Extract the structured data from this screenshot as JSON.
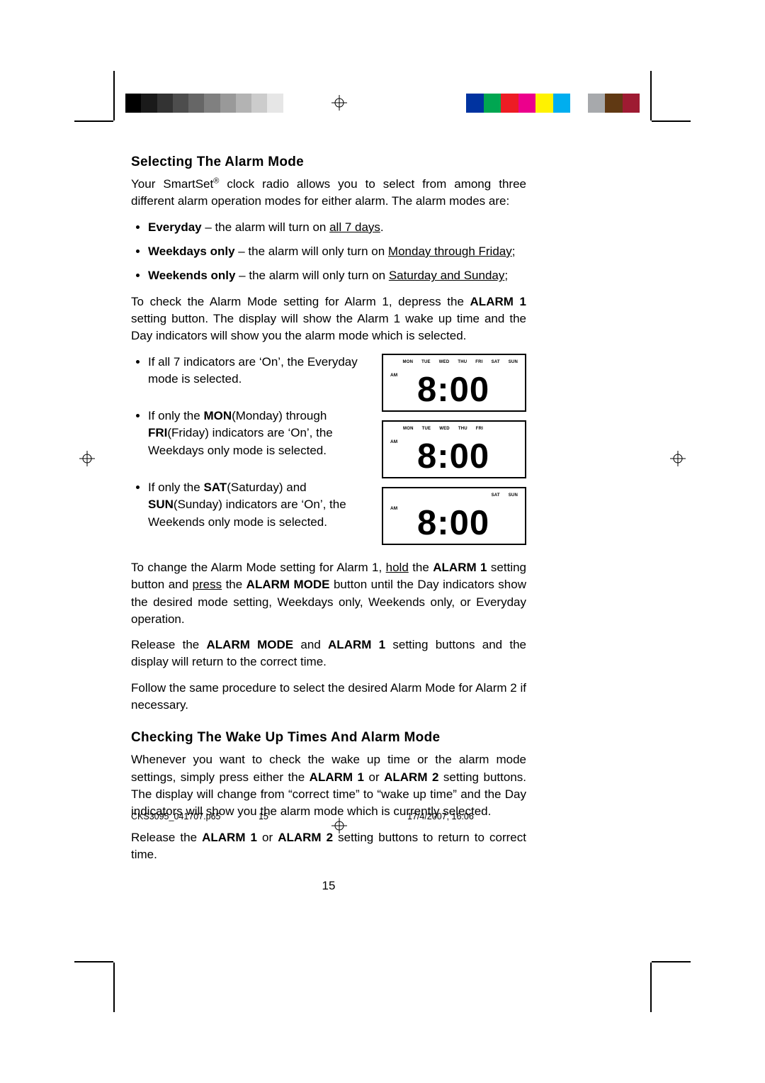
{
  "headings": {
    "h1": "Selecting The Alarm Mode",
    "h2": "Checking The Wake Up Times And Alarm Mode"
  },
  "intro": {
    "prefix": "Your SmartSet",
    "reg": "®",
    "rest": " clock radio allows you to select from among three different alarm operation modes for either alarm. The alarm modes are:"
  },
  "modes": {
    "everyday_b": "Everyday",
    "everyday_mid": " – the alarm will turn on ",
    "everyday_u": "all 7 days",
    "everyday_end": ".",
    "weekdays_b": "Weekdays only",
    "weekdays_mid": " – the alarm will only turn on ",
    "weekdays_u": "Monday through Friday",
    "weekdays_end": ";",
    "weekends_b": "Weekends only",
    "weekends_mid": " – the alarm will only turn on ",
    "weekends_u": "Saturday and Sunday",
    "weekends_end": ";"
  },
  "check": {
    "p1a": "To check the Alarm Mode setting for Alarm 1, depress the ",
    "p1b": "ALARM 1",
    "p1c": " setting button. The display will show the Alarm 1 wake up time and the Day indicators will show you the alarm mode which is selected."
  },
  "indicators": {
    "li1": "If all 7 indicators are ‘On’, the Everyday mode is selected.",
    "li2a": "If only the ",
    "li2b": "MON",
    "li2c": "(Monday) through ",
    "li2d": "FRI",
    "li2e": "(Friday) indicators are ‘On’, the Weekdays only mode is selected.",
    "li3a": "If only the ",
    "li3b": "SAT",
    "li3c": "(Saturday) and ",
    "li3d": "SUN",
    "li3e": "(Sunday) indicators are ‘On’, the Weekends only mode is selected."
  },
  "change": {
    "a": "To change the Alarm Mode setting for Alarm 1, ",
    "hold": "hold",
    "b": " the ",
    "alarm1": "ALARM 1",
    "c": " setting button and ",
    "press": "press",
    "d": " the ",
    "alarmmode": "ALARM MODE",
    "e": " button until the Day indicators show the desired mode setting, Weekdays only, Weekends only, or Everyday operation."
  },
  "release1": {
    "a": "Release the ",
    "b": "ALARM MODE",
    "c": " and ",
    "d": "ALARM 1",
    "e": " setting buttons and the display will return to the correct time."
  },
  "follow": "Follow the same procedure to select the desired Alarm Mode for Alarm 2 if necessary.",
  "checking": {
    "a": "Whenever you want to check the wake up time or the alarm mode settings, simply press either the ",
    "b": "ALARM 1",
    "c": " or ",
    "d": "ALARM 2",
    "e": " setting buttons. The display will change from “correct time” to “wake up time” and the Day indicators will show you the alarm mode which is currently selected."
  },
  "release2": {
    "a": "Release the ",
    "b": "ALARM 1",
    "c": " or ",
    "d": "ALARM 2",
    "e": " setting buttons to return to correct time."
  },
  "lcd": {
    "days_all": [
      "MON",
      "TUE",
      "WED",
      "THU",
      "FRI",
      "SAT",
      "SUN"
    ],
    "days_wk": [
      "MON",
      "TUE",
      "WED",
      "THU",
      "FRI"
    ],
    "days_we": [
      "SAT",
      "SUN"
    ],
    "ampm": "AM",
    "time": "8:00"
  },
  "page_number": "15",
  "footer": {
    "file": "CKS3095_041707.p65",
    "page": "15",
    "date": "17/4/2007, 16:06"
  },
  "colorbars": {
    "left": [
      "#000",
      "#1a1a1a",
      "#333",
      "#4d4d4d",
      "#666",
      "#808080",
      "#999",
      "#b3b3b3",
      "#ccc",
      "#e6e6e6",
      "#fff"
    ],
    "right": [
      "#0033a0",
      "#00a651",
      "#ed1c24",
      "#ec008c",
      "#fff200",
      "#00aeef",
      "#fff",
      "#a7a9ac",
      "#603913",
      "#9e1b32"
    ]
  }
}
